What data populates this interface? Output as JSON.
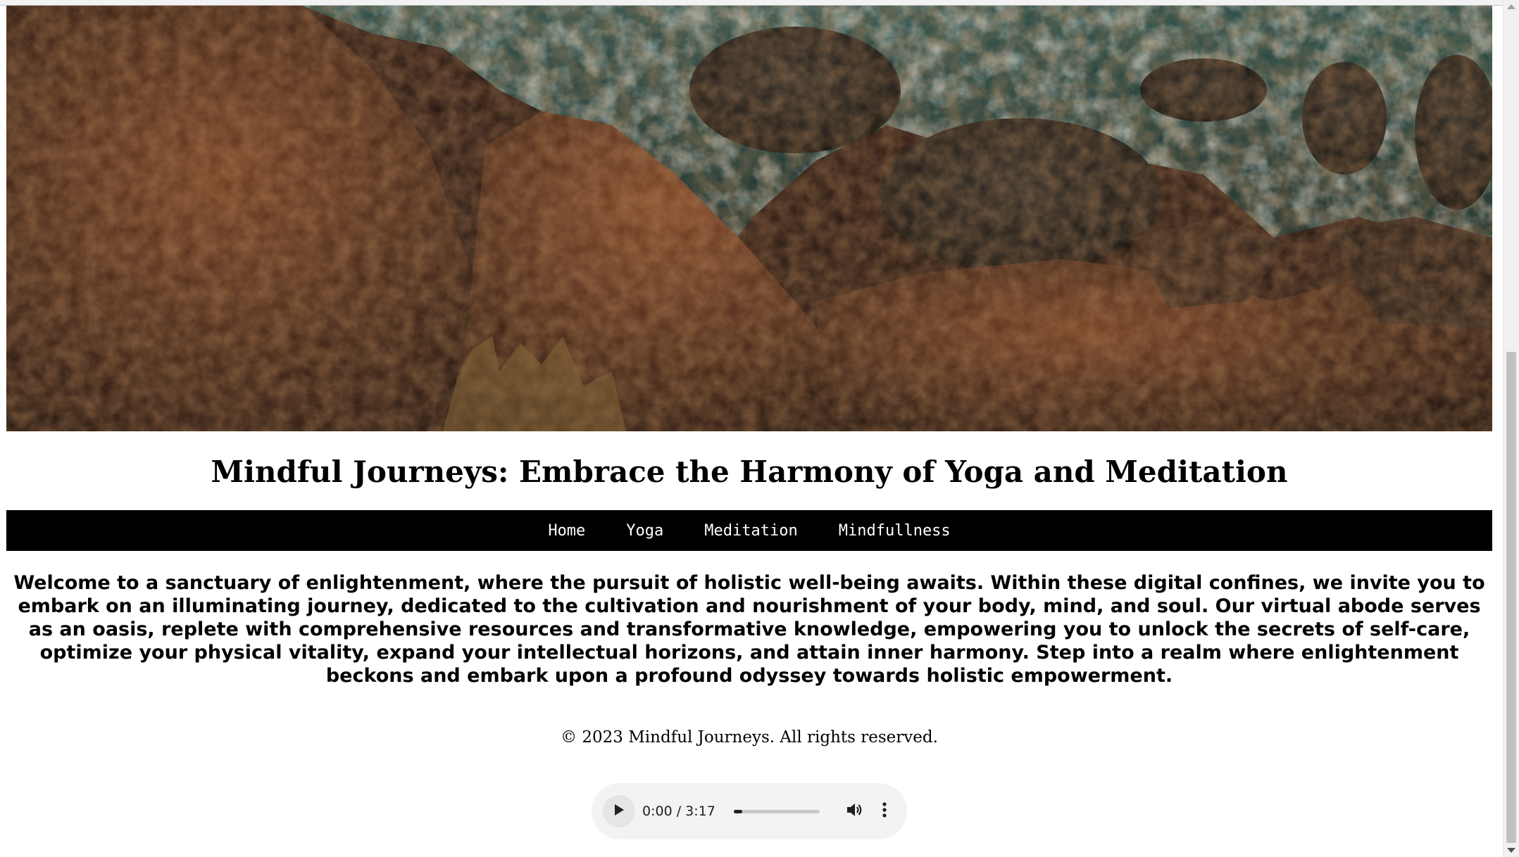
{
  "hero": {
    "image_alt": "Aerial view of ocean waves crashing against rocky coastline"
  },
  "site": {
    "title": "Mindful Journeys: Embrace the Harmony of Yoga and Meditation"
  },
  "nav": {
    "items": [
      {
        "label": "Home"
      },
      {
        "label": "Yoga"
      },
      {
        "label": "Meditation"
      },
      {
        "label": "Mindfullness"
      }
    ]
  },
  "main": {
    "intro": "Welcome to a sanctuary of enlightenment, where the pursuit of holistic well-being awaits. Within these digital confines, we invite you to embark on an illuminating journey, dedicated to the cultivation and nourishment of your body, mind, and soul. Our virtual abode serves as an oasis, replete with comprehensive resources and transformative knowledge, empowering you to unlock the secrets of self-care, optimize your physical vitality, expand your intellectual horizons, and attain inner harmony. Step into a realm where enlightenment beckons and embark upon a profound odyssey towards holistic empowerment."
  },
  "footer": {
    "copyright": "© 2023 Mindful Journeys. All rights reserved."
  },
  "audio_player": {
    "time_display": "0:00 / 3:17",
    "progress_fraction": 0.0,
    "play_icon": "play-icon",
    "volume_icon": "volume-icon",
    "menu_icon": "more-vert-icon"
  },
  "colors": {
    "nav_background": "#000000",
    "nav_text": "#ffffff",
    "player_background": "#f1f3f4"
  }
}
